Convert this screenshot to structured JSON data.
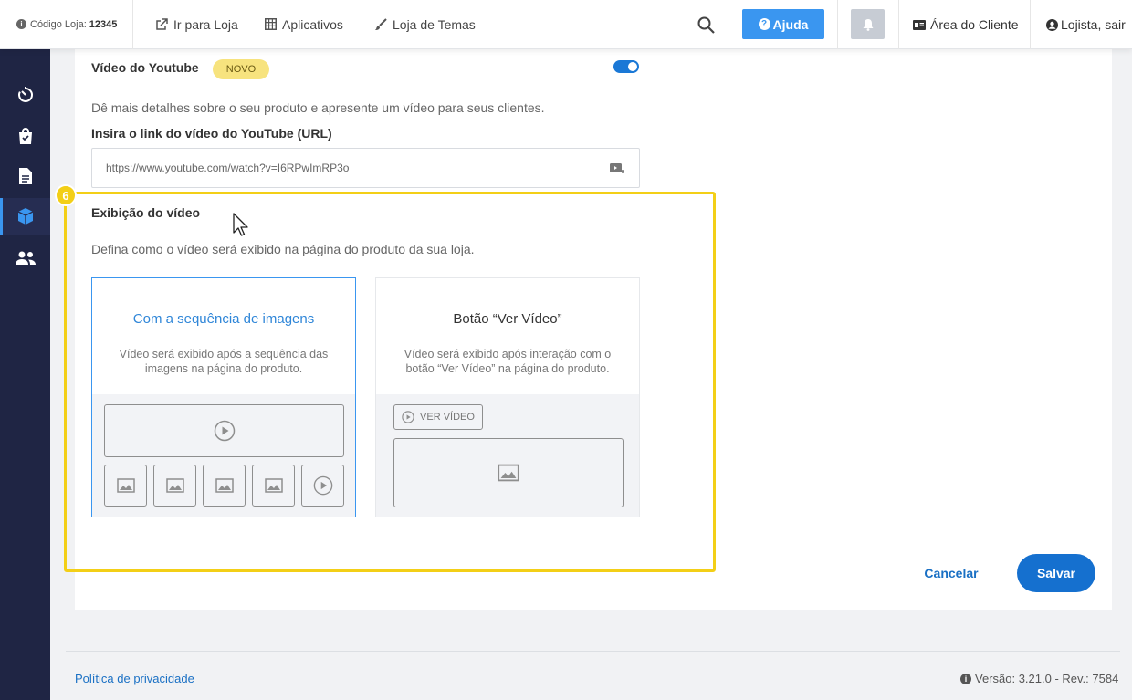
{
  "topbar": {
    "store_code_label": "Código Loja:",
    "store_code": "12345",
    "go_to_store": "Ir para Loja",
    "apps": "Aplicativos",
    "themes": "Loja de Temas",
    "help": "Ajuda",
    "client_area": "Área do Cliente",
    "user": "Lojista, sair"
  },
  "sidebar": {
    "items": [
      {
        "icon": "timer-icon"
      },
      {
        "icon": "shopping-bag-icon"
      },
      {
        "icon": "document-icon"
      },
      {
        "icon": "cube-icon",
        "active": true
      },
      {
        "icon": "users-icon"
      }
    ]
  },
  "youtube": {
    "title": "Vídeo do Youtube",
    "badge": "NOVO",
    "enabled": true,
    "description": "Dê mais detalhes sobre o seu produto e apresente um vídeo para seus clientes.",
    "url_label": "Insira o link do vídeo do YouTube (URL)",
    "url_value": "https://www.youtube.com/watch?v=I6RPwImRP3o"
  },
  "display": {
    "step": "6",
    "title": "Exibição do vídeo",
    "description": "Defina como o vídeo será exibido na página do produto da sua loja.",
    "options": [
      {
        "title": "Com a sequência de imagens",
        "description": "Vídeo será exibido após a sequência das imagens na página do produto.",
        "selected": true
      },
      {
        "title": "Botão “Ver Vídeo”",
        "description": "Vídeo será exibido após interação com o botão “Ver Vídeo” na página do produto.",
        "button_label": "VER VÍDEO",
        "selected": false
      }
    ]
  },
  "actions": {
    "cancel": "Cancelar",
    "save": "Salvar"
  },
  "footer": {
    "privacy": "Política de privacidade",
    "version": "Versão: 3.21.0 - Rev.: 7584"
  },
  "colors": {
    "accent": "#1570cf",
    "help_button": "#3a96f0",
    "highlight": "#f3cf17",
    "badge": "#f7e37e",
    "sidebar": "#1f2544"
  }
}
